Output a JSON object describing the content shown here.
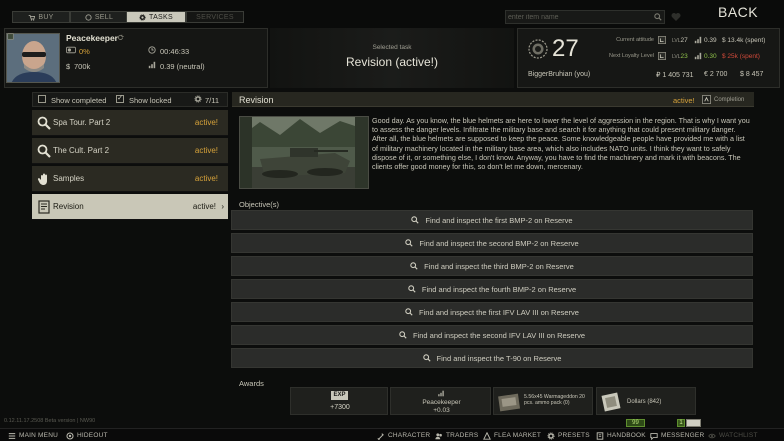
{
  "topbar": {
    "tabs": [
      {
        "label": "BUY",
        "icon": "cart-icon",
        "state": "normal"
      },
      {
        "label": "SELL",
        "icon": "coin-icon",
        "state": "normal"
      },
      {
        "label": "TASKS",
        "icon": "gear-icon",
        "state": "active"
      },
      {
        "label": "SERVICES",
        "icon": "",
        "state": "disabled"
      }
    ],
    "search_placeholder": "enter item name",
    "back_label": "BACK"
  },
  "player": {
    "name": "Peacekeeper",
    "progress": "0%",
    "timer": "00:46:33",
    "money": "700k",
    "standing": "0.39 (neutral)"
  },
  "task_header": {
    "caption": "Selected task",
    "title": "Revision (active!)"
  },
  "trader": {
    "level": "27",
    "player_name": "BiggerBruhian (you)",
    "current_attitude_label": "Current attitude",
    "next_loyalty_label": "Next Loyalty Level",
    "current": {
      "lvl": "27",
      "standing": "0.39",
      "spent": "13.4k (spent)"
    },
    "next": {
      "lvl": "23",
      "standing": "0.30",
      "spent": "25k (spent)"
    },
    "balances": {
      "rub": "1 405 731",
      "eur": "2 700",
      "usd": "8 457"
    }
  },
  "filters": {
    "show_completed": "Show completed",
    "show_locked": "Show locked",
    "count": "7/11"
  },
  "task_list": [
    {
      "label": "Spa Tour. Part 2",
      "status": "active!",
      "icon": "magnifier-icon",
      "selected": false
    },
    {
      "label": "The Cult. Part 2",
      "status": "active!",
      "icon": "magnifier-icon",
      "selected": false
    },
    {
      "label": "Samples",
      "status": "active!",
      "icon": "hand-icon",
      "selected": false
    },
    {
      "label": "Revision",
      "status": "active!",
      "icon": "document-icon",
      "selected": true
    }
  ],
  "task_detail": {
    "title": "Revision",
    "status": "active!",
    "completion_label": "Completion",
    "description": "Good day. As you know, the blue helmets are here to lower the level of aggression in the region. That is why I want you to assess the danger levels. Infiltrate the military base and search it for anything that could present military danger. After all, the blue helmets are supposed to keep the peace. Some knowledgeable people have provided me with a list of military machinery located in the military base area, which also includes NATO units. I think they want to safely dispose of it, or something else, I don't know. Anyway, you have to find the machinery and mark it with beacons. The clients offer good money for this, so don't let me down, mercenary.",
    "objectives_label": "Objective(s)",
    "objectives": [
      "Find and inspect the first BMP-2 on Reserve",
      "Find and inspect the second BMP-2 on Reserve",
      "Find and inspect the third BMP-2 on Reserve",
      "Find and inspect the fourth BMP-2 on Reserve",
      "Find and inspect the first IFV LAV III on Reserve",
      "Find and inspect the second IFV LAV III on Reserve",
      "Find and inspect the T-90 on Reserve"
    ],
    "awards_label": "Awards",
    "awards": {
      "exp_badge": "EXP",
      "exp_value": "+7300",
      "rep_name": "Peacekeeper",
      "rep_value": "+0.03",
      "item1": "5.56x45 Warmageddon 20 pcs. ammo pack (0)",
      "item2": "Dollars (842)"
    }
  },
  "version": "0.12.11.17.2508 Beta version | NW90",
  "bottombar": {
    "items": [
      {
        "label": "MAIN MENU",
        "icon": "menu-icon",
        "state": "normal"
      },
      {
        "label": "HIDEOUT",
        "icon": "hideout-icon",
        "state": "normal"
      },
      {
        "label": "CHARACTER",
        "icon": "character-icon",
        "state": "normal"
      },
      {
        "label": "TRADERS",
        "icon": "traders-icon",
        "state": "normal"
      },
      {
        "label": "FLEA MARKET",
        "icon": "flea-icon",
        "state": "normal"
      },
      {
        "label": "PRESETS",
        "icon": "presets-icon",
        "state": "normal"
      },
      {
        "label": "HANDBOOK",
        "icon": "handbook-icon",
        "state": "normal"
      },
      {
        "label": "MESSENGER",
        "icon": "messenger-icon",
        "state": "normal"
      },
      {
        "label": "WATCHLIST",
        "icon": "watchlist-icon",
        "state": "disabled"
      }
    ],
    "badge_messages": "99",
    "badge_other": "1"
  },
  "colors": {
    "accent_active": "#d6a23a",
    "selected_row": "#c9c7b7",
    "loyalty_green": "#8fc14a",
    "loyalty_red": "#d24a3a"
  }
}
